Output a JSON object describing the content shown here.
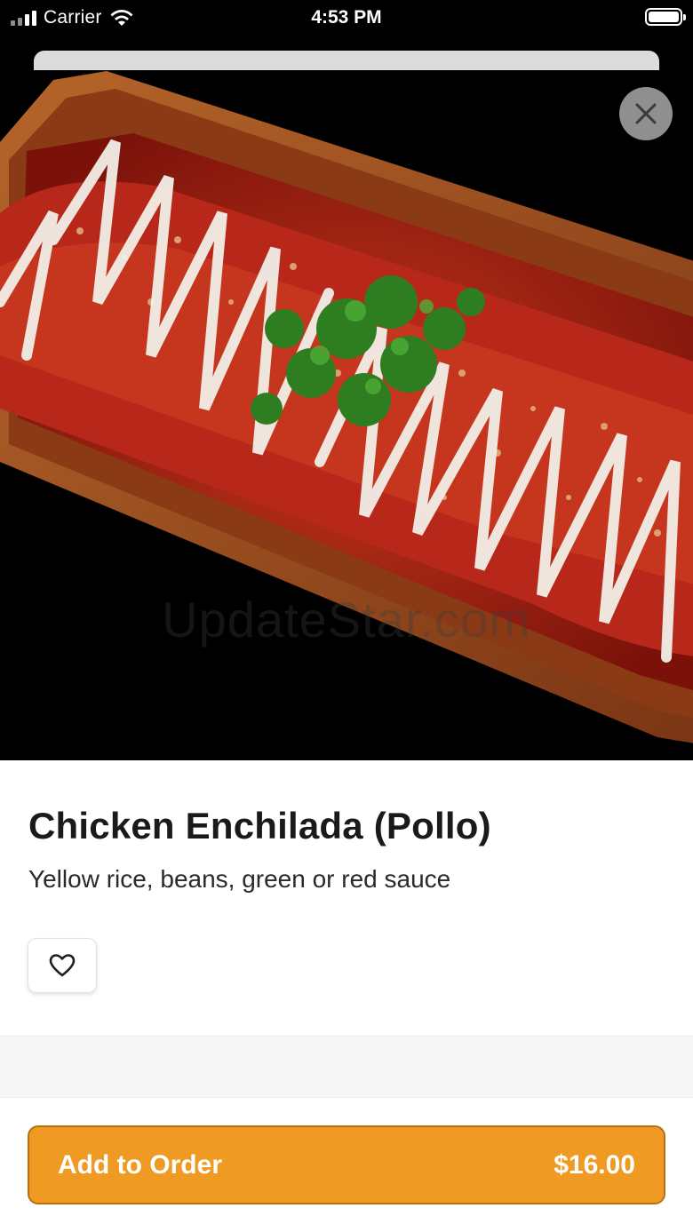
{
  "status_bar": {
    "carrier": "Carrier",
    "time": "4:53 PM"
  },
  "hero": {
    "image_subject": "chicken enchilada on a plate with red sauce, sour cream drizzle and cilantro",
    "watermark": "UpdateStar.com",
    "close_icon": "close-icon"
  },
  "item": {
    "title": "Chicken Enchilada (Pollo)",
    "description": "Yellow rice, beans, green or red sauce",
    "favorite_icon": "heart-icon"
  },
  "footer": {
    "add_label": "Add to Order",
    "price": "$16.00"
  },
  "colors": {
    "accent": "#ef9a23",
    "accent_border": "#b86f10",
    "hero_background": "#000000"
  }
}
